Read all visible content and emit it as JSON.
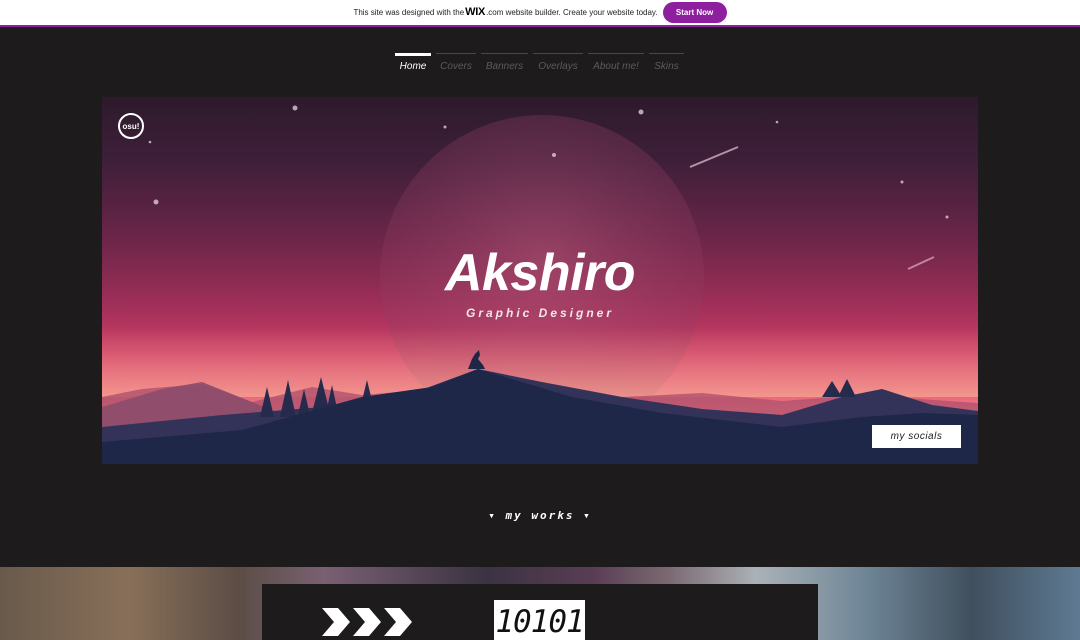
{
  "wix_banner": {
    "message_before": "This site was designed with the ",
    "logo": "WIX",
    "message_after": ".com website builder. Create your website today.",
    "button_label": "Start Now"
  },
  "nav": {
    "items": [
      {
        "label": "Home",
        "active": true
      },
      {
        "label": "Covers",
        "active": false
      },
      {
        "label": "Banners",
        "active": false
      },
      {
        "label": "Overlays",
        "active": false
      },
      {
        "label": "About me!",
        "active": false
      },
      {
        "label": "Skins",
        "active": false
      }
    ]
  },
  "hero": {
    "logo_text": "osu!",
    "title": "Akshiro",
    "subtitle": "Graphic Designer",
    "socials_button": "my socials"
  },
  "works": {
    "heading": "▾ my works ▾"
  },
  "bottom": {
    "binary_text": "10101"
  },
  "colors": {
    "page_background": "#1d1b1c",
    "brand_purple": "#8e1f9e",
    "hero_pink": "#cf3d67",
    "mountain_navy": "#1f2748"
  }
}
